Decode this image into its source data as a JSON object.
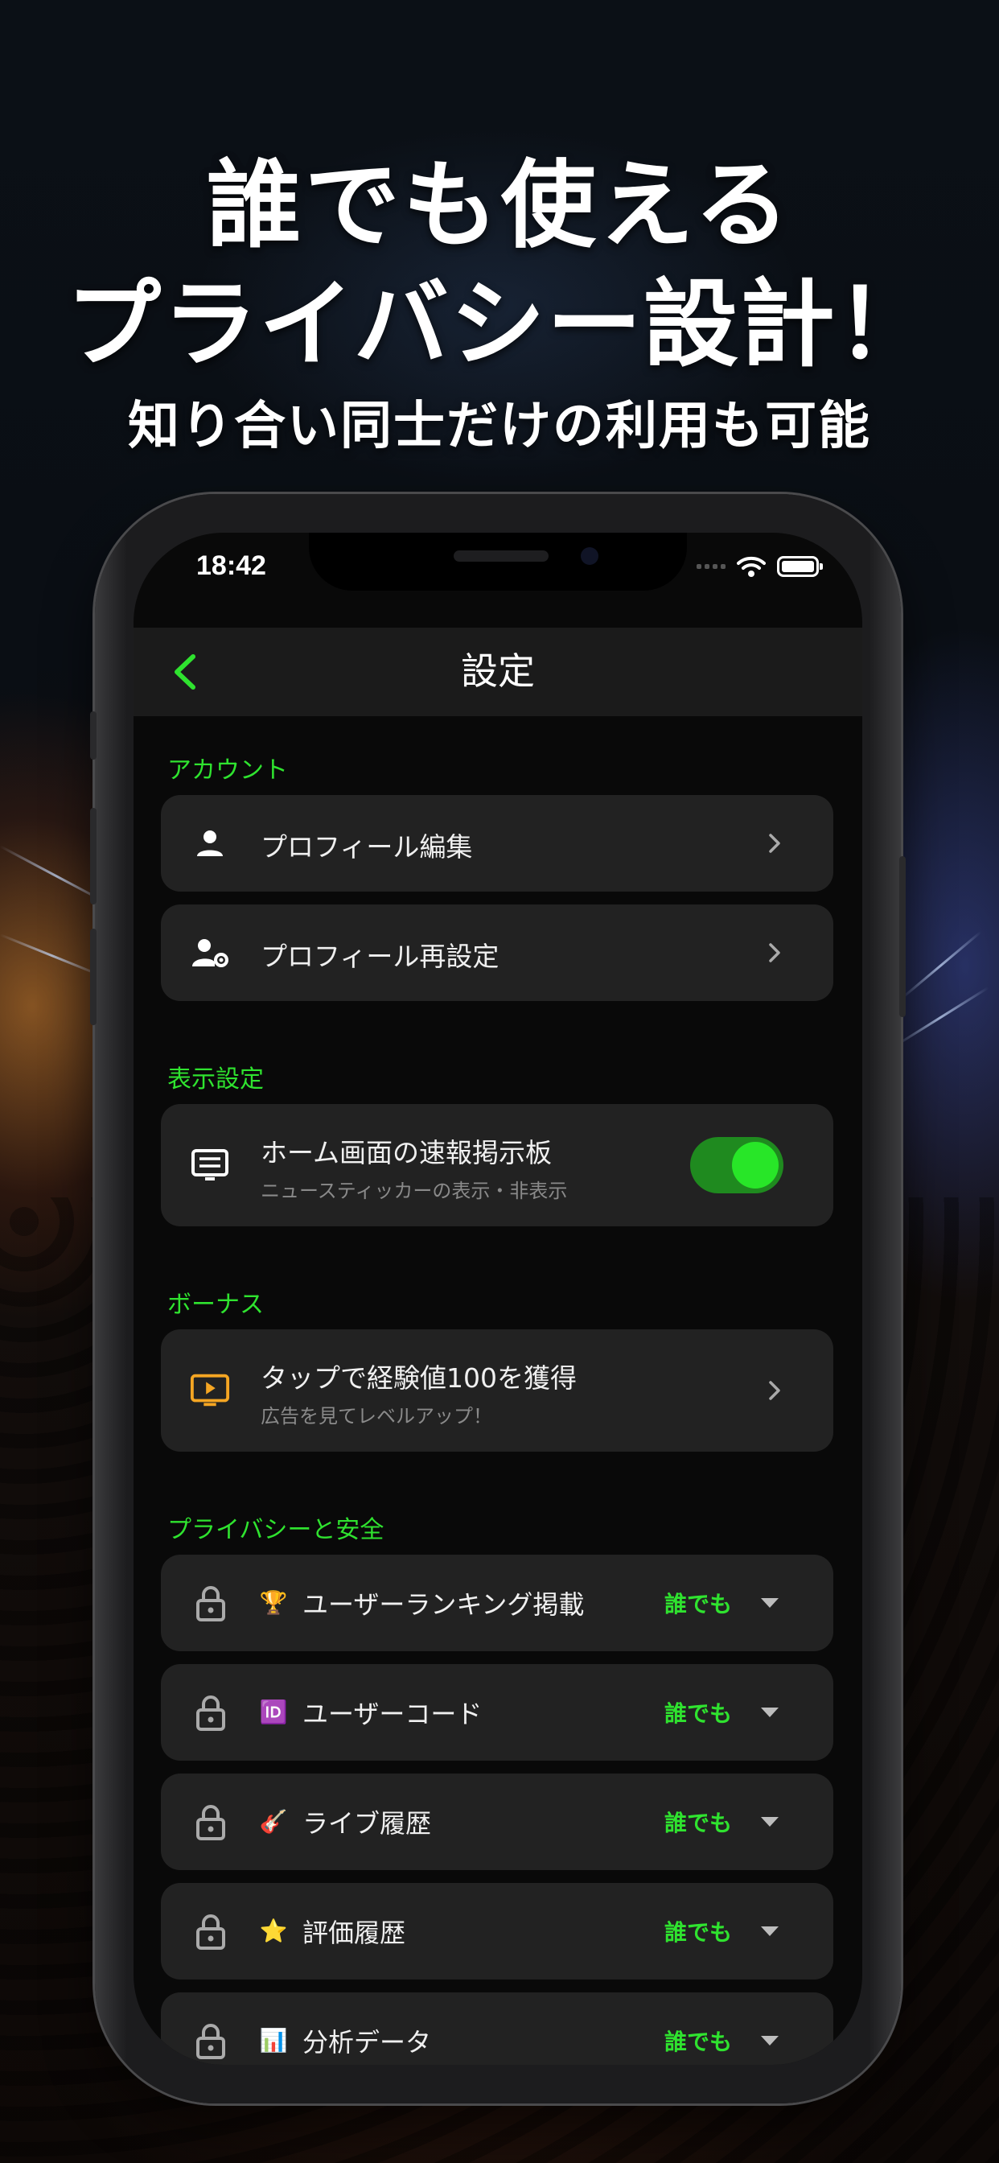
{
  "headline": {
    "line1": "誰でも使える",
    "line2": "プライバシー設計！",
    "line3": "知り合い同士だけの利用も可能"
  },
  "status_bar": {
    "time": "18:42"
  },
  "nav": {
    "title": "設定",
    "back_icon": "chevron-left-icon"
  },
  "colors": {
    "accent": "#2fe32f",
    "card": "#222222",
    "background": "#090909",
    "navbar": "#1b1b1b",
    "ad_icon": "#f5a623"
  },
  "sections": {
    "account": {
      "header": "アカウント",
      "items": [
        {
          "label": "プロフィール編集",
          "icon": "person-icon"
        },
        {
          "label": "プロフィール再設定",
          "icon": "person-gear-icon"
        }
      ]
    },
    "display": {
      "header": "表示設定",
      "item": {
        "label": "ホーム画面の速報掲示板",
        "sublabel": "ニュースティッカーの表示・非表示",
        "icon": "ticker-board-icon",
        "toggle_on": true
      }
    },
    "bonus": {
      "header": "ボーナス",
      "item": {
        "label": "タップで経験値100を獲得",
        "sublabel": "広告を見てレベルアップ！",
        "icon": "video-ad-icon"
      }
    },
    "privacy": {
      "header": "プライバシーと安全",
      "items": [
        {
          "emoji": "🏆",
          "label": "ユーザーランキング掲載",
          "value": "誰でも"
        },
        {
          "emoji": "🆔",
          "label": "ユーザーコード",
          "value": "誰でも"
        },
        {
          "emoji": "🎸",
          "label": "ライブ履歴",
          "value": "誰でも"
        },
        {
          "emoji": "⭐",
          "label": "評価履歴",
          "value": "誰でも"
        },
        {
          "emoji": "📊",
          "label": "分析データ",
          "value": "誰でも"
        }
      ]
    }
  }
}
